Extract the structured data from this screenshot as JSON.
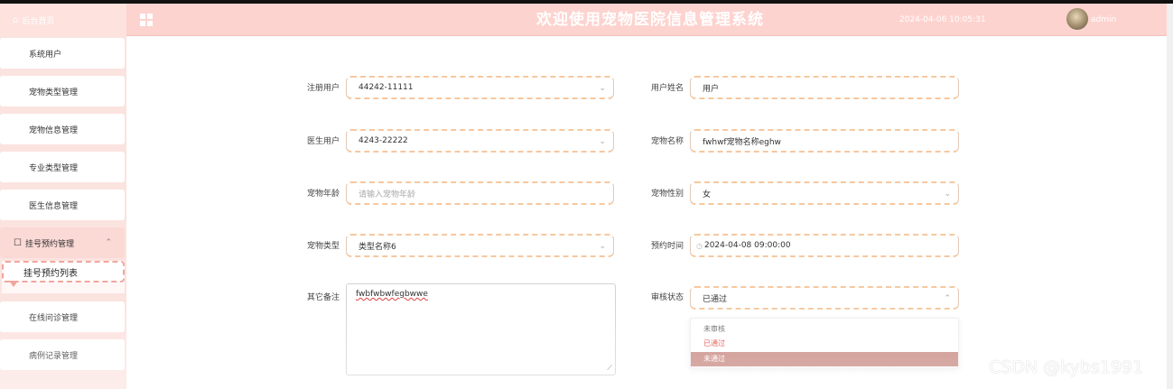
{
  "header": {
    "home_label": "后台首页",
    "title": "欢迎使用宠物医院信息管理系统",
    "datetime": "2024-04-06 10:05:31",
    "username": "admin",
    "accent_color": "#fdd3cf"
  },
  "sidebar": {
    "items": [
      {
        "label": "系统用户"
      },
      {
        "label": "宠物类型管理"
      },
      {
        "label": "宠物信息管理"
      },
      {
        "label": "专业类型管理"
      },
      {
        "label": "医生信息管理"
      },
      {
        "label": "挂号预约管理",
        "expanded": true
      },
      {
        "label": "在线问诊管理"
      },
      {
        "label": "病例记录管理"
      }
    ],
    "subitem": {
      "label": "挂号预约列表"
    }
  },
  "form": {
    "left": [
      {
        "label": "注册用户",
        "value": "44242-11111",
        "type": "select"
      },
      {
        "label": "医生用户",
        "value": "4243-22222",
        "type": "select"
      },
      {
        "label": "宠物年龄",
        "value": "",
        "placeholder": "请输入宠物年龄",
        "type": "input"
      },
      {
        "label": "宠物类型",
        "value": "类型名称6",
        "type": "select"
      },
      {
        "label": "其它备注",
        "value": "fwbfwbwfegbwwe",
        "type": "textarea"
      }
    ],
    "right": [
      {
        "label": "用户姓名",
        "value": "用户",
        "type": "input"
      },
      {
        "label": "宠物名称",
        "value": "fwhwf宠物名称eghw",
        "type": "input"
      },
      {
        "label": "宠物性别",
        "value": "女",
        "type": "select"
      },
      {
        "label": "预约时间",
        "value": "2024-04-08 09:00:00",
        "type": "datetime"
      },
      {
        "label": "审核状态",
        "value": "已通过",
        "type": "select",
        "open": true
      }
    ],
    "status_options": [
      "未审核",
      "已通过",
      "未通过"
    ]
  },
  "watermark": "CSDN @kybs1991"
}
